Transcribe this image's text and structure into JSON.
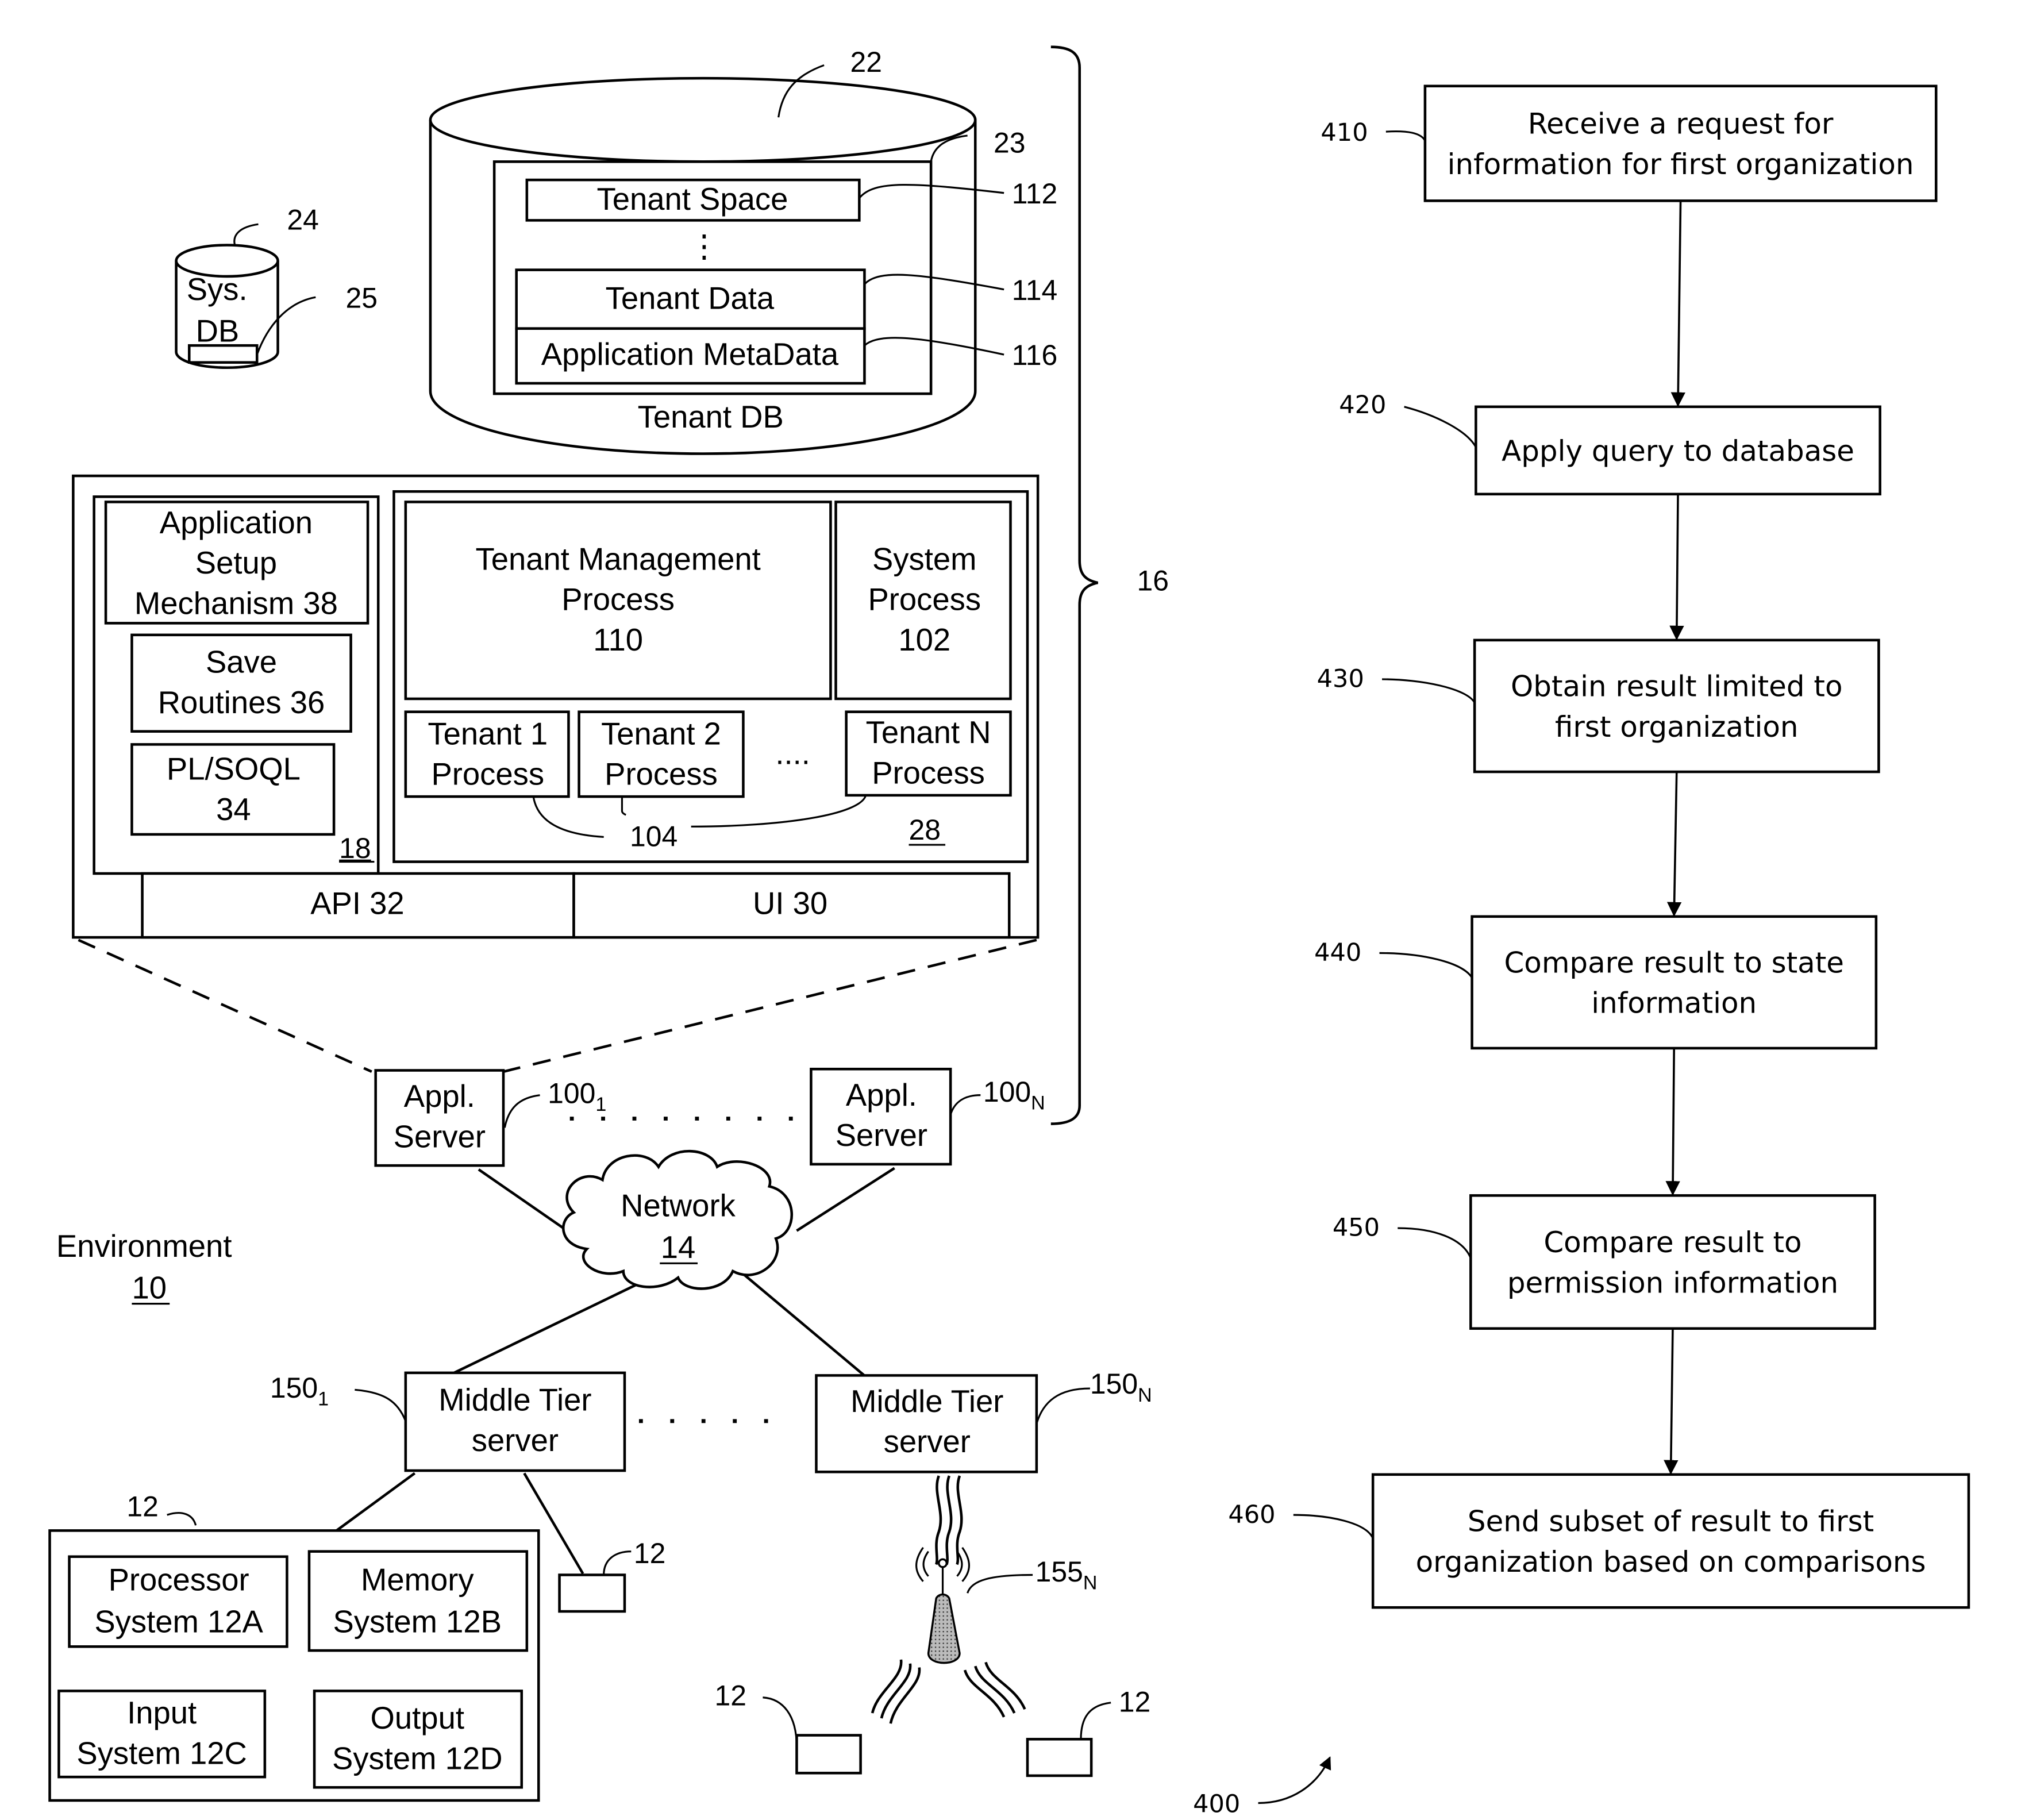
{
  "environment": {
    "title": "Environment",
    "ref": "10"
  },
  "tenant_db": {
    "ref": "22",
    "label": "Tenant DB",
    "container_ref": "23",
    "tenant_space": {
      "label": "Tenant Space",
      "ref": "112"
    },
    "ellipsis": "⋮",
    "tenant_data": {
      "label": "Tenant Data",
      "ref": "114"
    },
    "app_metadata": {
      "label": "Application MetaData",
      "ref": "116"
    }
  },
  "sys_db": {
    "ref": "24",
    "line1": "Sys.",
    "line2": "DB",
    "inner_ref": "25"
  },
  "system_brace_ref": "16",
  "app_platform": {
    "ref": "18",
    "app_setup": [
      "Application",
      "Setup",
      "Mechanism 38"
    ],
    "save_routines": [
      "Save",
      "Routines 36"
    ],
    "plsoql": [
      "PL/SOQL",
      "34"
    ]
  },
  "process_space": {
    "ref": "28",
    "tenant_mgmt": [
      "Tenant Management",
      "Process",
      "110"
    ],
    "system_process": [
      "System",
      "Process",
      "102"
    ],
    "tenant1": [
      "Tenant 1",
      "Process"
    ],
    "tenant2": [
      "Tenant 2",
      "Process"
    ],
    "ellipsis": "....",
    "tenantN": [
      "Tenant N",
      "Process"
    ],
    "tenant_process_ref": "104"
  },
  "api": "API 32",
  "ui": "UI 30",
  "app_servers": {
    "server1": [
      "Appl.",
      "Server"
    ],
    "server1_ref": "100",
    "server1_sub": "1",
    "serverN": [
      "Appl.",
      "Server"
    ],
    "serverN_ref": "100",
    "serverN_sub": "N"
  },
  "network": {
    "label": "Network",
    "ref": "14"
  },
  "middle_tier": {
    "server1": [
      "Middle Tier",
      "server"
    ],
    "server1_ref": "150",
    "server1_sub": "1",
    "serverN": [
      "Middle Tier",
      "server"
    ],
    "serverN_ref": "150",
    "serverN_sub": "N"
  },
  "user_system": {
    "ref": "12",
    "processor": [
      "Processor",
      "System 12A"
    ],
    "memory": [
      "Memory",
      "System 12B"
    ],
    "input": [
      "Input",
      "System 12C"
    ],
    "output": [
      "Output",
      "System 12D"
    ]
  },
  "small_device_ref": "12",
  "wireless": {
    "tower_ref": "155",
    "tower_sub": "N",
    "device_left_ref": "12",
    "device_right_ref": "12"
  },
  "flowchart": {
    "ref": "400",
    "steps": [
      {
        "ref": "410",
        "lines": [
          "Receive a request for",
          "information for first organization"
        ]
      },
      {
        "ref": "420",
        "lines": [
          "Apply query to database"
        ]
      },
      {
        "ref": "430",
        "lines": [
          "Obtain result limited to",
          "first organization"
        ]
      },
      {
        "ref": "440",
        "lines": [
          "Compare result to state",
          "information"
        ]
      },
      {
        "ref": "450",
        "lines": [
          "Compare result to",
          "permission information"
        ]
      },
      {
        "ref": "460",
        "lines": [
          "Send subset of result to first",
          "organization based on comparisons"
        ]
      }
    ]
  }
}
